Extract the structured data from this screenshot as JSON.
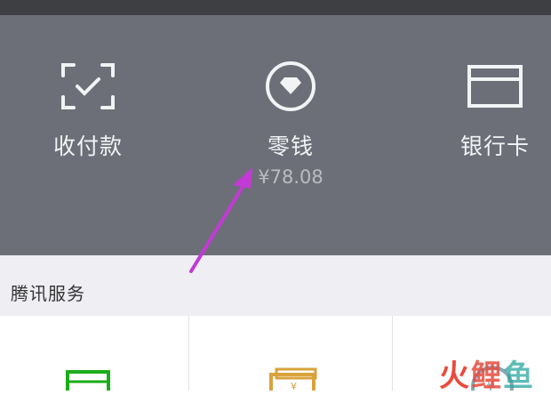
{
  "wallet": {
    "items": [
      {
        "label": "收付款",
        "icon": "scan-qr-check-icon"
      },
      {
        "label": "零钱",
        "amount": "¥78.08",
        "icon": "diamond-circle-icon"
      },
      {
        "label": "银行卡",
        "icon": "bank-card-icon"
      }
    ]
  },
  "section": {
    "title": "腾讯服务"
  },
  "watermark": {
    "text1": "火",
    "text2": "鲤",
    "text3": "鱼"
  },
  "colors": {
    "header_bg": "#6c6f77",
    "section_bg": "#efeef3",
    "annotation_arrow": "#c23ad6",
    "tile_green": "#1aad19",
    "tile_gold": "#d9a23b"
  }
}
